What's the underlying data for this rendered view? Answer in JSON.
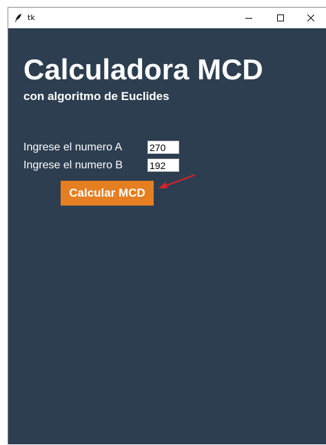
{
  "window": {
    "title": "tk"
  },
  "header": {
    "title": "Calculadora MCD",
    "subtitle": "con algoritmo de Euclides"
  },
  "form": {
    "label_a": "Ingrese el numero A",
    "value_a": "270",
    "label_b": "Ingrese el numero B",
    "value_b": "192"
  },
  "actions": {
    "calculate_label": "Calcular MCD"
  },
  "colors": {
    "background": "#2c3e50",
    "button": "#e67e22",
    "annotation_arrow": "#e0202a"
  }
}
